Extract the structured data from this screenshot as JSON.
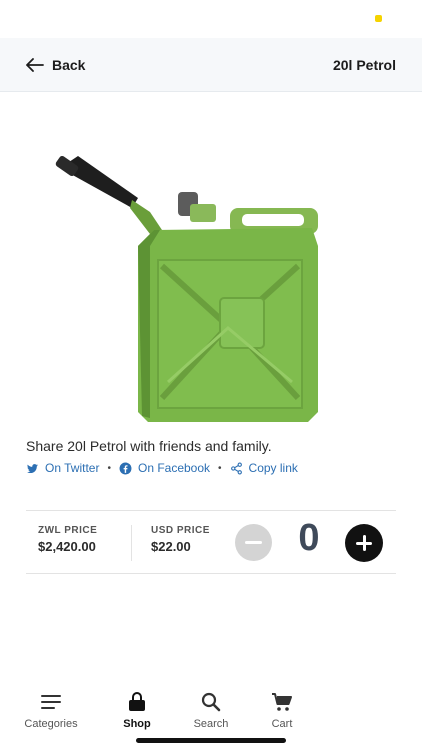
{
  "header": {
    "back_label": "Back",
    "title": "20l Petrol"
  },
  "product": {
    "image_icon": "jerry-can-image"
  },
  "share": {
    "title": "Share 20l Petrol with friends and family.",
    "twitter_label": "On Twitter",
    "facebook_label": "On Facebook",
    "copy_label": "Copy link",
    "separator": "•"
  },
  "pricing": {
    "zwl_label": "ZWL PRICE",
    "zwl_value": "$2,420.00",
    "usd_label": "USD PRICE",
    "usd_value": "$22.00",
    "quantity": "0"
  },
  "nav": {
    "items": [
      {
        "label": "Categories",
        "icon": "menu-icon"
      },
      {
        "label": "Shop",
        "icon": "shopping-bag-icon",
        "active": true
      },
      {
        "label": "Search",
        "icon": "search-icon"
      },
      {
        "label": "Cart",
        "icon": "cart-icon"
      }
    ]
  },
  "colors": {
    "link": "#2c6fb3",
    "status_dot": "#f5d300",
    "can_green": "#7ab648"
  }
}
